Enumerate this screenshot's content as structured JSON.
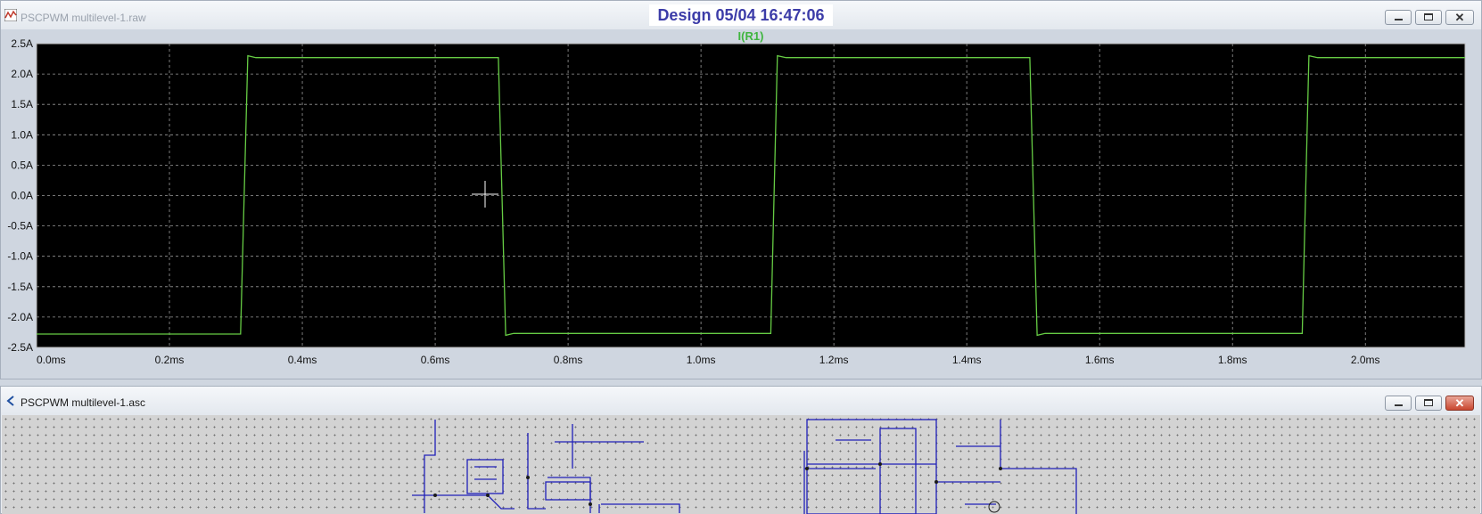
{
  "waveform_window": {
    "title": "PSCPWM multilevel-1.raw",
    "header_stamp": "Design  05/04  16:47:06",
    "trace_label": "I(R1)",
    "colors": {
      "background": "#000000",
      "trace": "#66cc44",
      "grid": "#9a9a9a",
      "axis_text": "#ffffff"
    }
  },
  "schematic_window": {
    "title": "PSCPWM multilevel-1.asc",
    "colors": {
      "wire": "#2020b8",
      "background": "#d3d3d3"
    }
  },
  "chart_data": {
    "type": "line",
    "title": "I(R1)",
    "xlabel": "",
    "ylabel": "",
    "x_unit": "ms",
    "y_unit": "A",
    "xlim": [
      0,
      2.15
    ],
    "ylim": [
      -2.5,
      2.5
    ],
    "x_ticks": [
      "0.0ms",
      "0.2ms",
      "0.4ms",
      "0.6ms",
      "0.8ms",
      "1.0ms",
      "1.2ms",
      "1.4ms",
      "1.6ms",
      "1.8ms",
      "2.0ms"
    ],
    "y_ticks": [
      "2.5A",
      "2.0A",
      "1.5A",
      "1.0A",
      "0.5A",
      "0.0A",
      "-0.5A",
      "-1.0A",
      "-1.5A",
      "-2.0A",
      "-2.5A"
    ],
    "grid": true,
    "series": [
      {
        "name": "I(R1)",
        "x": [
          0.0,
          0.307,
          0.318,
          0.33,
          0.695,
          0.706,
          0.718,
          1.105,
          1.115,
          1.128,
          1.495,
          1.506,
          1.518,
          1.905,
          1.915,
          1.928,
          2.15
        ],
        "y": [
          -2.28,
          -2.28,
          2.3,
          2.27,
          2.27,
          -2.3,
          -2.27,
          -2.27,
          2.3,
          2.27,
          2.27,
          -2.3,
          -2.27,
          -2.27,
          2.3,
          2.27,
          2.27
        ]
      }
    ]
  }
}
